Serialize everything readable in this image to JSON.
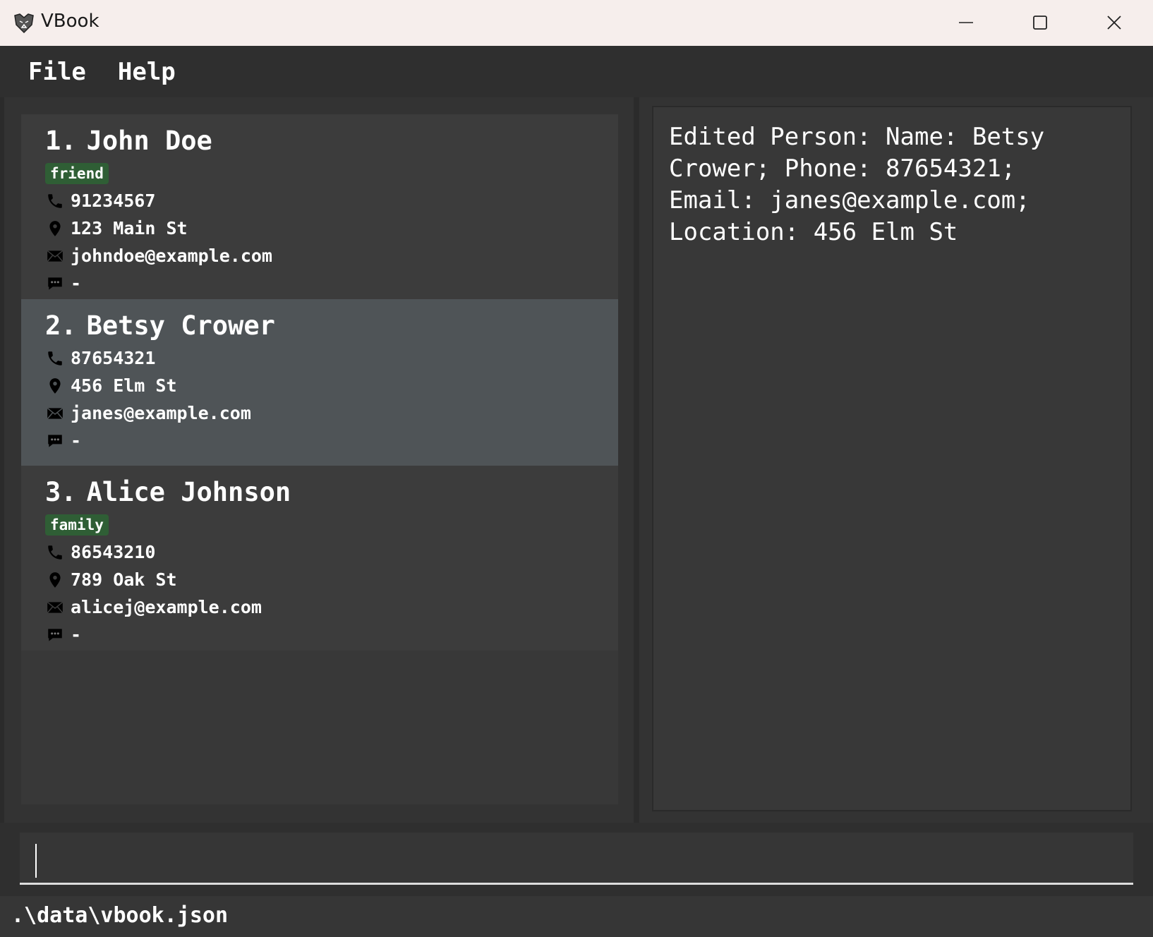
{
  "window": {
    "title": "VBook",
    "logo_icon": "lion-logo-icon",
    "controls": [
      "minimize-icon",
      "maximize-icon",
      "close-icon"
    ]
  },
  "menu": {
    "items": [
      "File",
      "Help"
    ]
  },
  "persons": [
    {
      "index": "1.",
      "name": "John Doe",
      "tag": "friend",
      "phone": "91234567",
      "location": "123 Main St",
      "email": "johndoe@example.com",
      "remark": "-"
    },
    {
      "index": "2.",
      "name": "Betsy Crower",
      "tag": "",
      "phone": "87654321",
      "location": "456 Elm St",
      "email": "janes@example.com",
      "remark": "-"
    },
    {
      "index": "3.",
      "name": "Alice Johnson",
      "tag": "family",
      "phone": "86543210",
      "location": "789 Oak St",
      "email": "alicej@example.com",
      "remark": "-"
    }
  ],
  "result": {
    "message": "Edited Person: Name: Betsy\nCrower; Phone: 87654321;\nEmail: janes@example.com;\nLocation: 456 Elm St"
  },
  "command": {
    "value": ""
  },
  "status": {
    "path": ".\\data\\vbook.json"
  },
  "colors": {
    "tag_bg": "#2f5e35",
    "selected_card_bg": "#4f5457",
    "card_bg": "#3c3c3c"
  }
}
